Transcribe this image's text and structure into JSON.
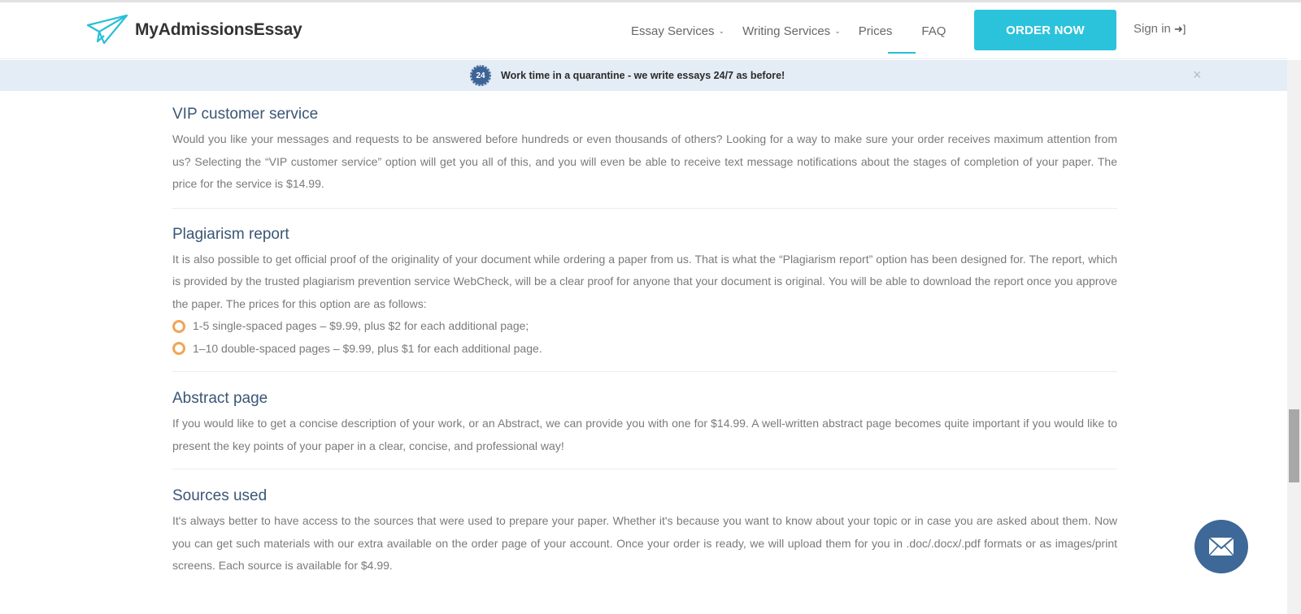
{
  "brand": {
    "name": "MyAdmissionsEssay",
    "accent": "#2bc3dc",
    "heading_color": "#3a5675",
    "bullet_color": "#f0a556"
  },
  "nav": {
    "items": [
      {
        "label": "Essay Services",
        "has_dropdown": true
      },
      {
        "label": "Writing Services",
        "has_dropdown": true
      },
      {
        "label": "Prices",
        "has_dropdown": false,
        "active": true
      },
      {
        "label": "FAQ",
        "has_dropdown": false
      }
    ],
    "order_button": "ORDER NOW",
    "sign_in": "Sign in"
  },
  "banner": {
    "badge": "24",
    "text": "Work time in a quarantine - we write essays 24/7 as before!",
    "close": "×"
  },
  "sections": [
    {
      "title": "VIP customer service",
      "body": "Would you like your messages and requests to be answered before hundreds or even thousands of others? Looking for a way to make sure your order receives maximum attention from us? Selecting the “VIP customer service” option will get you all of this, and you will even be able to receive text message notifications about the stages of completion of your paper. The price for the service is $14.99."
    },
    {
      "title": "Plagiarism report",
      "body": "It is also possible to get official proof of the originality of your document while ordering a paper from us. That is what the “Plagiarism report” option has been designed for. The report, which is provided by the trusted plagiarism prevention service WebCheck, will be a clear proof for anyone that your document is original. You will be able to download the report once you approve the paper. The prices for this option are as follows:",
      "bullets": [
        "1-5 single-spaced pages – $9.99, plus $2 for each additional page;",
        "1–10 double-spaced pages – $9.99, plus $1 for each additional page."
      ]
    },
    {
      "title": "Abstract page",
      "body": "If you would like to get a concise description of your work, or an Abstract, we can provide you with one for $14.99. A well-written abstract page becomes quite important if you would like to present the key points of your paper in a clear, concise, and professional way!"
    },
    {
      "title": "Sources used",
      "body": "It's always better to have access to the sources that were used to prepare your paper. Whether it's because you want to know about your topic or in case you are asked about them. Now you can get such materials with our extra available on the order page of your account. Once your order is ready, we will upload them for you in .doc/.docx/.pdf formats or as images/print screens. Each source is available for $4.99."
    }
  ]
}
